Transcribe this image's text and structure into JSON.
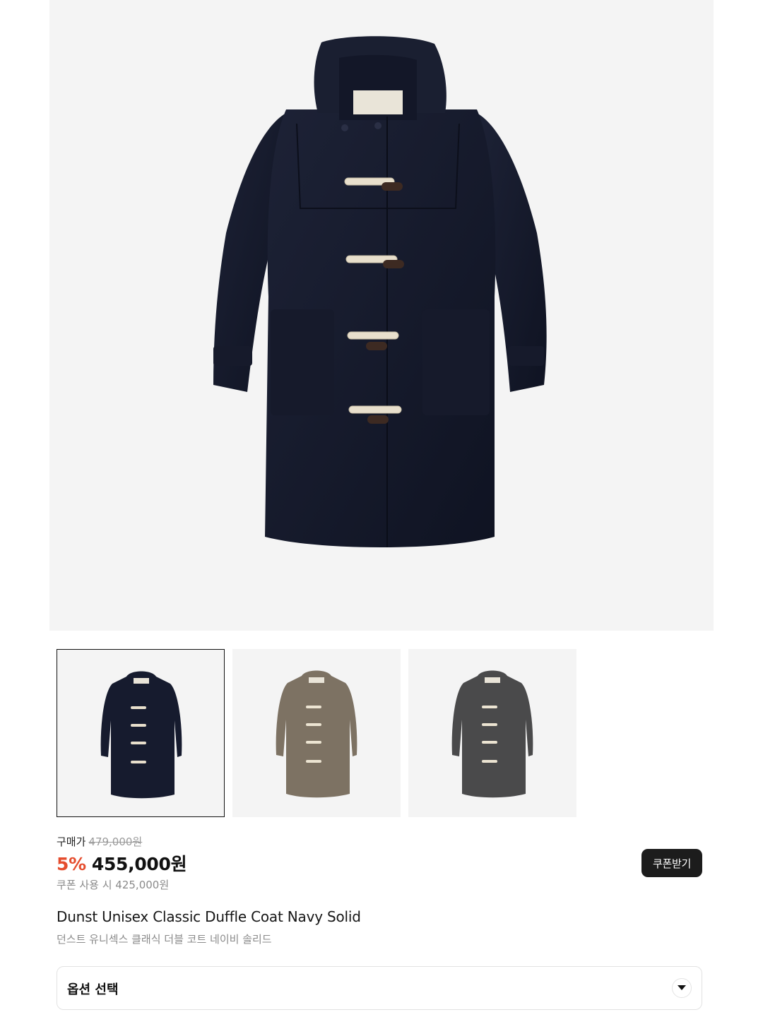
{
  "product": {
    "price_label": "구매가",
    "original_price": "479,000원",
    "discount": "5%",
    "sale_price": "455,000원",
    "coupon_price_text": "쿠폰 사용 시 425,000원",
    "coupon_button_label": "쿠폰받기",
    "name_en": "Dunst Unisex Classic Duffle Coat Navy Solid",
    "name_ko": "던스트 유니섹스 클래식 더블 코트 네이비 솔리드"
  },
  "option_select": {
    "label": "옵션 선택"
  },
  "thumbnails": [
    {
      "color": "#161b2e",
      "selected": true
    },
    {
      "color": "#7d7263",
      "selected": false
    },
    {
      "color": "#4a4a4b",
      "selected": false
    }
  ],
  "colors": {
    "accent_discount": "#e54d2e",
    "button_dark": "#1c1c1c",
    "hero_bg": "#f4f4f4"
  }
}
